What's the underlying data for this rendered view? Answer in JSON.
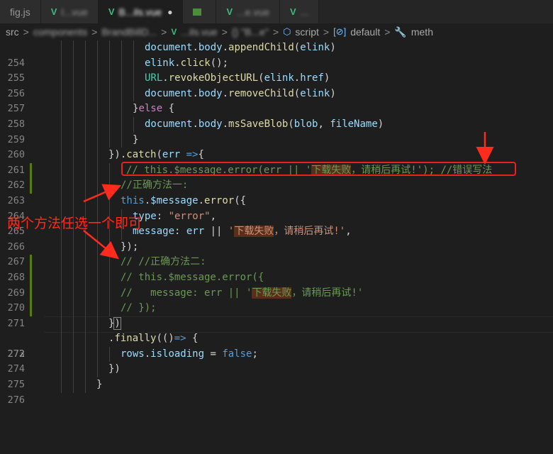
{
  "tabs": [
    {
      "label": "fig.js",
      "icon": "javascript-icon",
      "active": false
    },
    {
      "label": "l...vue",
      "icon": "vue-icon",
      "active": false,
      "blurred": true
    },
    {
      "label": "B...ils.vue",
      "icon": "vue-icon",
      "active": true,
      "blurred": true
    },
    {
      "label": "",
      "icon": "image-icon",
      "active": false
    },
    {
      "label": "...e.vue",
      "icon": "vue-icon",
      "active": false,
      "blurred": true
    },
    {
      "label": "...",
      "icon": "vue-icon",
      "active": false,
      "blurred": true
    }
  ],
  "breadcrumb": {
    "items": [
      "src",
      "components",
      "BrandBillD...",
      "...ils.vue",
      "{} \"B...e\"",
      "script",
      "default",
      "meth"
    ],
    "separator": ">"
  },
  "editor": {
    "current_line": 272,
    "lines": [
      {
        "n": 254,
        "code": "document.body.appendChild(elink)"
      },
      {
        "n": 255,
        "code": "elink.click();"
      },
      {
        "n": 256,
        "code": "URL.revokeObjectURL(elink.href)"
      },
      {
        "n": 257,
        "code": "document.body.removeChild(elink)"
      },
      {
        "n": 258,
        "code": "}else {"
      },
      {
        "n": 259,
        "code": "document.body.msSaveBlob(blob, fileName)"
      },
      {
        "n": 260,
        "code": "}"
      },
      {
        "n": 261,
        "code": "}).catch(err =>{"
      },
      {
        "n": 262,
        "code": "// this.$message.error(err || '下载失败，请稍后再试!'); //错误写法"
      },
      {
        "n": 263,
        "code": "//正确方法一:"
      },
      {
        "n": 264,
        "code": "this.$message.error({"
      },
      {
        "n": 265,
        "code": "type: \"error\","
      },
      {
        "n": 266,
        "code": "message: err || '下载失败，请稍后再试!',"
      },
      {
        "n": 267,
        "code": "});"
      },
      {
        "n": 268,
        "code": "// //正确方法二:"
      },
      {
        "n": 269,
        "code": "// this.$message.error({"
      },
      {
        "n": 270,
        "code": "//   message: err || '下载失败，请稍后再试!'"
      },
      {
        "n": 271,
        "code": "// });"
      },
      {
        "n": 272,
        "code": "})"
      },
      {
        "n": 273,
        "code": ".finally(()=> {"
      },
      {
        "n": 274,
        "code": "rows.isloading = false;"
      },
      {
        "n": 275,
        "code": "})"
      },
      {
        "n": 276,
        "code": "}"
      }
    ]
  },
  "annotation": {
    "text": "两个方法任选一个即可",
    "color": "#ff2b1c"
  },
  "colors": {
    "modified_gutter": "#587c0c",
    "highlight_bg": "#5a2f1a",
    "comment": "#6a9955",
    "string": "#ce9178"
  }
}
